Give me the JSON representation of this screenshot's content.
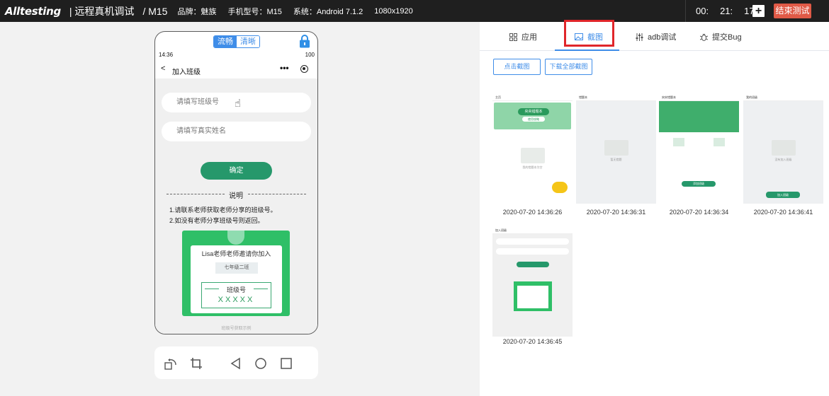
{
  "topbar": {
    "logo": "Alltesting",
    "title": "| 远程真机调试",
    "model": "/ M15",
    "brand": "品牌：魅族",
    "phone_model": "手机型号：M15",
    "system": "系统：Android 7.1.2",
    "resolution": "1080x1920",
    "timer": {
      "h": "00:",
      "m": "21:",
      "s": "17"
    },
    "plus_label": "+",
    "end_label": "结束测试"
  },
  "phone": {
    "mode_fluent": "流畅",
    "mode_clear": "清晰",
    "status_time": "14:36",
    "status_battery": "100",
    "nav_title": "加入班级",
    "nav_back": "<",
    "nav_more": "•••",
    "class_placeholder": "请填写班级号",
    "name_placeholder": "请填写真实姓名",
    "confirm_label": "确定",
    "desc_title": "说明",
    "desc_1": "1.请联系老师获取老师分享的班级号。",
    "desc_2": "2.如没有老师分享班级号则返回。",
    "invite_heading": "Lisa老师老师邀请你加入",
    "invite_grade": "七年级二班",
    "invite_label": "班级号",
    "invite_code": "XXXXX",
    "caption": "班级号获取示例"
  },
  "tabs": [
    {
      "label": "应用",
      "icon": "grid-icon"
    },
    {
      "label": "截图",
      "icon": "image-icon"
    },
    {
      "label": "adb调试",
      "icon": "sliders-icon"
    },
    {
      "label": "提交Bug",
      "icon": "bug-icon"
    }
  ],
  "actions": {
    "capture_label": "点击截图",
    "download_label": "下载全部截图"
  },
  "screenshots": [
    {
      "timestamp": "2020-07-20 14:36:26",
      "title": "主页",
      "banner": "央央错题本",
      "banner_sub": "使用攻略",
      "empty": "我的错题本为空"
    },
    {
      "timestamp": "2020-07-20 14:36:31",
      "title": "错题本",
      "empty": "暂无错题"
    },
    {
      "timestamp": "2020-07-20 14:36:34",
      "title": "央央错题本",
      "btn": "添加班级"
    },
    {
      "timestamp": "2020-07-20 14:36:41",
      "title": "我的班级",
      "empty": "没有加入班级",
      "btn": "加入班级"
    },
    {
      "timestamp": "2020-07-20 14:36:45",
      "title": "加入班级"
    }
  ],
  "colors": {
    "accent": "#3f8de8",
    "green": "#26986b",
    "end": "#e05a47",
    "highlight": "#e0262a"
  }
}
